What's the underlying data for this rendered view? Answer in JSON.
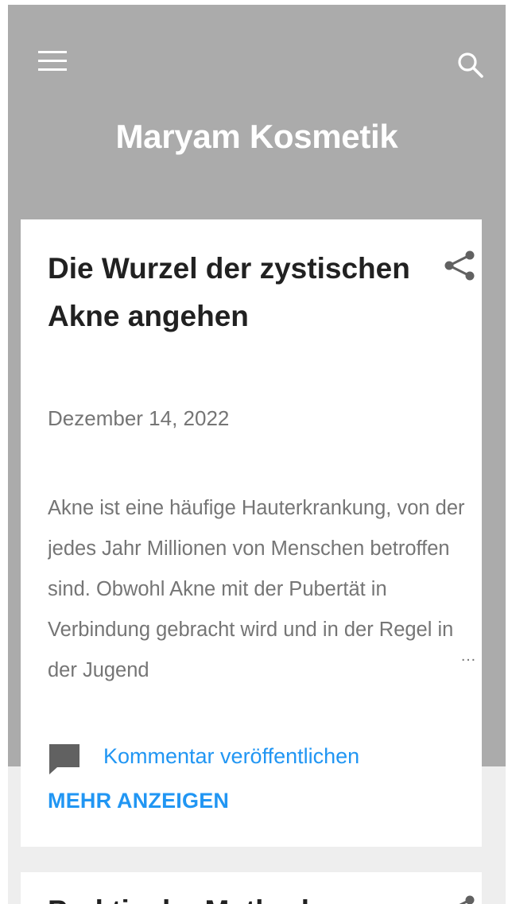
{
  "blog": {
    "title": "Maryam Kosmetik"
  },
  "header": {
    "menu_icon": "hamburger-menu-icon",
    "search_icon": "search-icon"
  },
  "post": {
    "title": "Die Wurzel der zystischen Akne angehen",
    "date": "Dezember 14, 2022",
    "snippet": "Akne ist eine häufige Hauterkrankung, von der jedes Jahr Millionen von Menschen betroffen sind. Obwohl Akne mit der Pubertät in Verbindung gebracht wird und in der Regel in der Jugend",
    "ellipsis": "…",
    "share_icon": "share-icon",
    "comment_icon": "comment-icon",
    "comment_label": "Kommentar veröffentlichen",
    "more_label": "MEHR ANZEIGEN"
  },
  "next_post": {
    "title_partial": "Praktische Methoden",
    "share_icon": "share-icon"
  },
  "colors": {
    "header": "#ababab",
    "background": "#eeeeee",
    "link": "#2196f3",
    "title_text": "#212121",
    "secondary_text": "#757575"
  }
}
